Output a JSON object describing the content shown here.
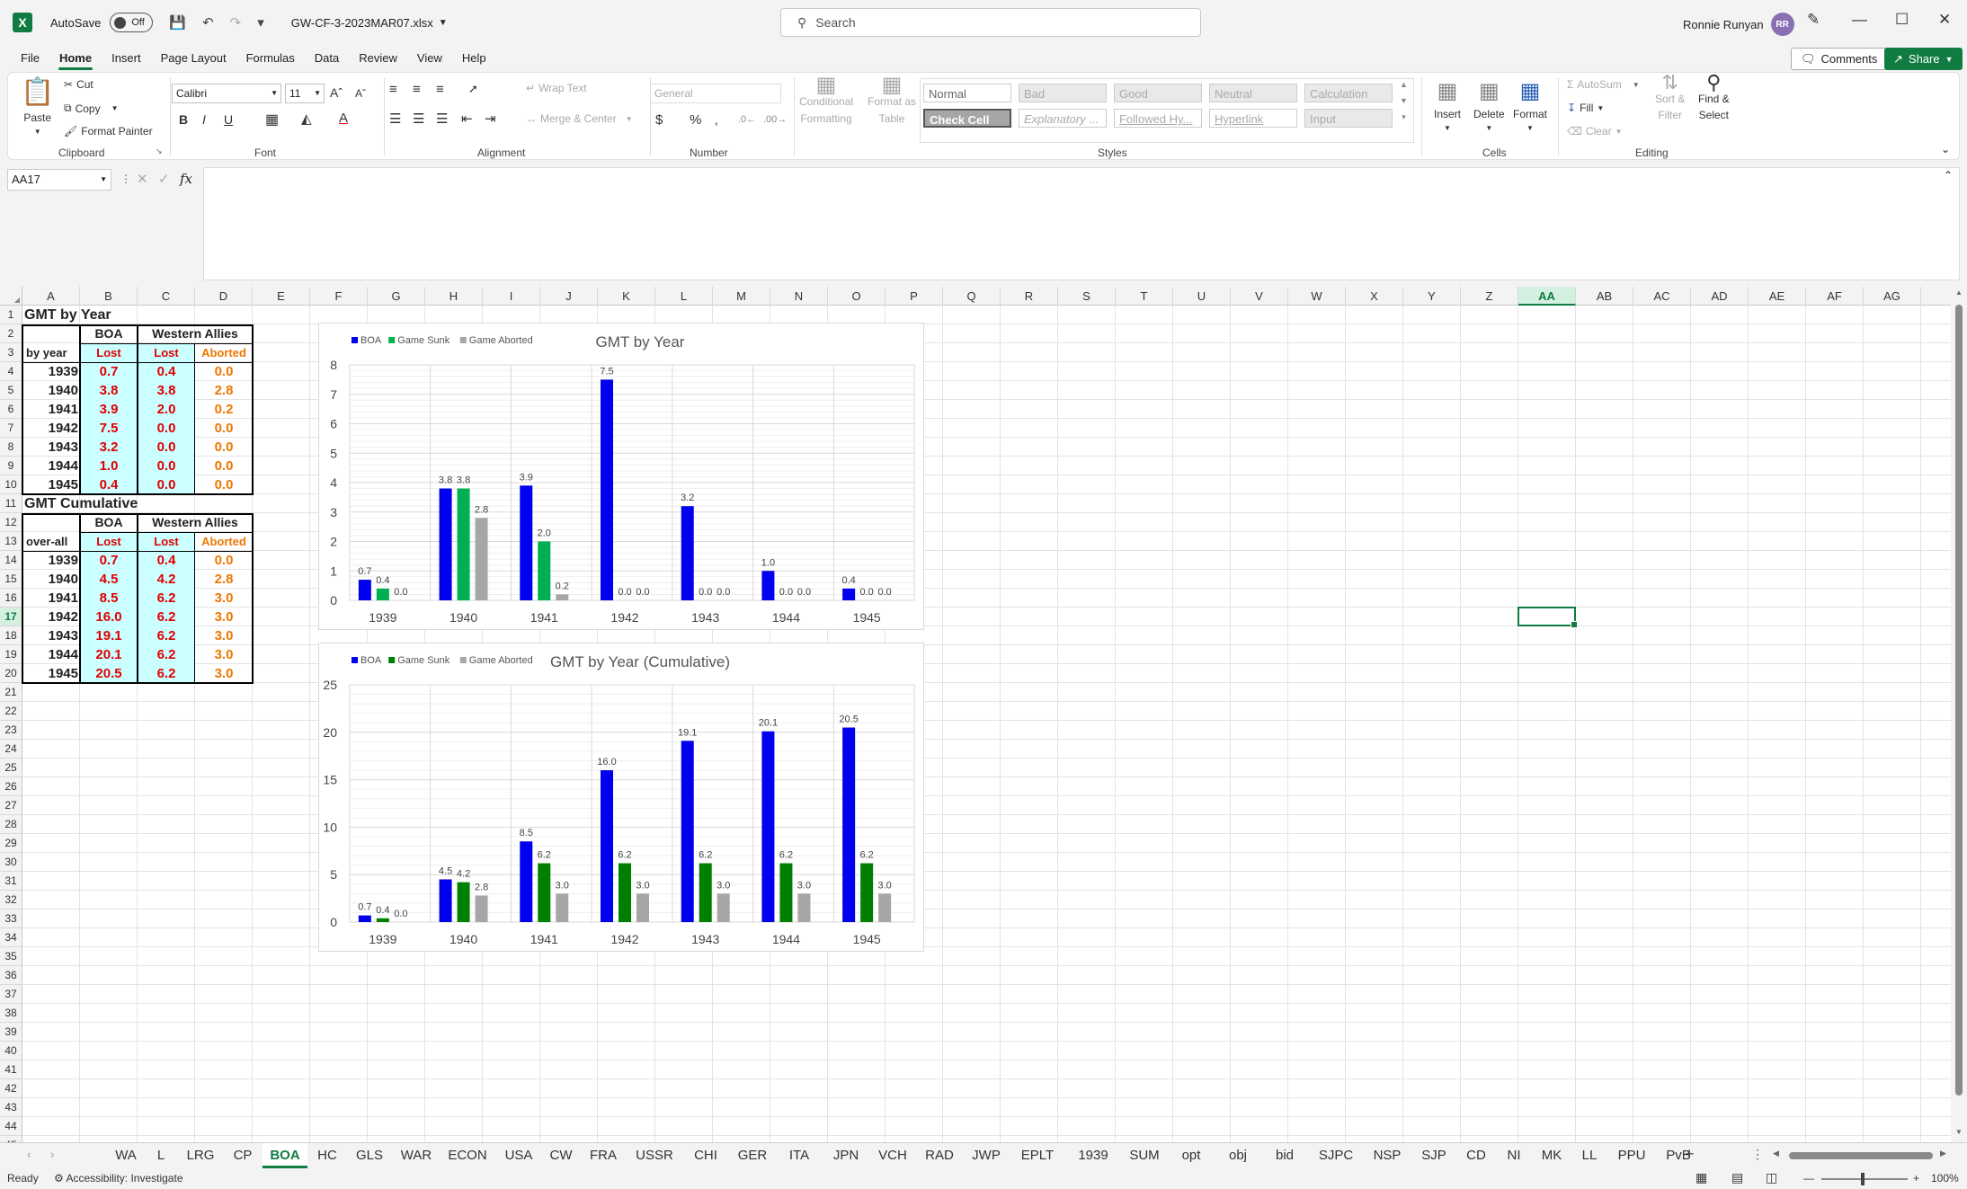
{
  "titlebar": {
    "autosave_label": "AutoSave",
    "autosave_state": "Off",
    "filename": "GW-CF-3-2023MAR07.xlsx",
    "search_placeholder": "Search",
    "user_name": "Ronnie Runyan",
    "user_initials": "RR"
  },
  "ribbon_tabs": [
    "File",
    "Home",
    "Insert",
    "Page Layout",
    "Formulas",
    "Data",
    "Review",
    "View",
    "Help"
  ],
  "active_tab": "Home",
  "comments_label": "Comments",
  "share_label": "Share",
  "ribbon": {
    "paste": "Paste",
    "cut": "Cut",
    "copy": "Copy",
    "format_painter": "Format Painter",
    "clipboard": "Clipboard",
    "font_name": "Calibri",
    "font_size": "11",
    "font": "Font",
    "wrap_text": "Wrap Text",
    "merge_center": "Merge & Center",
    "alignment": "Alignment",
    "number_format": "General",
    "number": "Number",
    "conditional_formatting_1": "Conditional",
    "conditional_formatting_2": "Formatting",
    "format_as_table_1": "Format as",
    "format_as_table_2": "Table",
    "styles": [
      "Normal",
      "Bad",
      "Good",
      "Neutral",
      "Calculation",
      "Check Cell",
      "Explanatory ...",
      "Followed Hy...",
      "Hyperlink",
      "Input"
    ],
    "styles_label": "Styles",
    "insert": "Insert",
    "delete": "Delete",
    "format": "Format",
    "cells": "Cells",
    "autosum": "AutoSum",
    "fill": "Fill",
    "clear": "Clear",
    "sort_filter_1": "Sort &",
    "sort_filter_2": "Filter",
    "find_select_1": "Find &",
    "find_select_2": "Select",
    "editing": "Editing"
  },
  "formula_bar": {
    "name_box": "AA17",
    "fx": "fx",
    "content": ""
  },
  "columns": [
    "A",
    "B",
    "C",
    "D",
    "E",
    "F",
    "G",
    "H",
    "I",
    "J",
    "K",
    "L",
    "M",
    "N",
    "O",
    "P",
    "Q",
    "R",
    "S",
    "T",
    "U",
    "V",
    "W",
    "X",
    "Y",
    "Z",
    "AA",
    "AB",
    "AC",
    "AD",
    "AE",
    "AF",
    "AG"
  ],
  "selected_column": "AA",
  "rows": [
    "1",
    "2",
    "3",
    "4",
    "5",
    "6",
    "7",
    "8",
    "9",
    "10",
    "11",
    "12",
    "13",
    "14",
    "15",
    "16",
    "17",
    "18",
    "19",
    "20",
    "21",
    "22",
    "23",
    "24",
    "25",
    "26",
    "27",
    "28",
    "29",
    "30",
    "31",
    "32",
    "33",
    "34",
    "35",
    "36",
    "37",
    "38",
    "39",
    "40",
    "41",
    "42",
    "43",
    "44",
    "45"
  ],
  "selected_row": "17",
  "table1": {
    "title": "GMT by Year",
    "hdr_boa": "BOA",
    "hdr_wa": "Western Allies",
    "row_label": "by year",
    "sub_lost": "Lost",
    "sub_lost2": "Lost",
    "sub_aborted": "Aborted",
    "years": [
      "1939",
      "1940",
      "1941",
      "1942",
      "1943",
      "1944",
      "1945"
    ],
    "boa": [
      "0.7",
      "3.8",
      "3.9",
      "7.5",
      "3.2",
      "1.0",
      "0.4"
    ],
    "wa_lost": [
      "0.4",
      "3.8",
      "2.0",
      "0.0",
      "0.0",
      "0.0",
      "0.0"
    ],
    "wa_aborted": [
      "0.0",
      "2.8",
      "0.2",
      "0.0",
      "0.0",
      "0.0",
      "0.0"
    ]
  },
  "table2": {
    "title": "GMT Cumulative",
    "hdr_boa": "BOA",
    "hdr_wa": "Western Allies",
    "row_label": "over-all",
    "sub_lost": "Lost",
    "sub_lost2": "Lost",
    "sub_aborted": "Aborted",
    "years": [
      "1939",
      "1940",
      "1941",
      "1942",
      "1943",
      "1944",
      "1945"
    ],
    "boa": [
      "0.7",
      "4.5",
      "8.5",
      "16.0",
      "19.1",
      "20.1",
      "20.5"
    ],
    "wa_lost": [
      "0.4",
      "4.2",
      "6.2",
      "6.2",
      "6.2",
      "6.2",
      "6.2"
    ],
    "wa_aborted": [
      "0.0",
      "2.8",
      "3.0",
      "3.0",
      "3.0",
      "3.0",
      "3.0"
    ]
  },
  "chart_data": [
    {
      "type": "bar",
      "title": "GMT by Year",
      "categories": [
        "1939",
        "1940",
        "1941",
        "1942",
        "1943",
        "1944",
        "1945"
      ],
      "series": [
        {
          "name": "BOA",
          "values": [
            0.7,
            3.8,
            3.9,
            7.5,
            3.2,
            1.0,
            0.4
          ],
          "color": "#0000ee"
        },
        {
          "name": "Game Sunk",
          "values": [
            0.4,
            3.8,
            2.0,
            0.0,
            0.0,
            0.0,
            0.0
          ],
          "color": "#00b050"
        },
        {
          "name": "Game Aborted",
          "values": [
            0.0,
            2.8,
            0.2,
            0.0,
            0.0,
            0.0,
            0.0
          ],
          "color": "#a6a6a6"
        }
      ],
      "ylim": [
        0,
        8
      ],
      "yticks": [
        0,
        1,
        2,
        3,
        4,
        5,
        6,
        7,
        8
      ],
      "legend": "top-left",
      "grid": true
    },
    {
      "type": "bar",
      "title": "GMT by Year (Cumulative)",
      "categories": [
        "1939",
        "1940",
        "1941",
        "1942",
        "1943",
        "1944",
        "1945"
      ],
      "series": [
        {
          "name": "BOA",
          "values": [
            0.7,
            4.5,
            8.5,
            16.0,
            19.1,
            20.1,
            20.5
          ],
          "color": "#0000ee"
        },
        {
          "name": "Game Sunk",
          "values": [
            0.4,
            4.2,
            6.2,
            6.2,
            6.2,
            6.2,
            6.2
          ],
          "color": "#008000"
        },
        {
          "name": "Game Aborted",
          "values": [
            0.0,
            2.8,
            3.0,
            3.0,
            3.0,
            3.0,
            3.0
          ],
          "color": "#a6a6a6"
        }
      ],
      "ylim": [
        0,
        25
      ],
      "yticks": [
        0,
        5,
        10,
        15,
        20,
        25
      ],
      "legend": "top-left",
      "grid": true
    }
  ],
  "sheet_tabs": [
    "WA",
    "L",
    "LRG",
    "CP",
    "BOA",
    "HC",
    "GLS",
    "WAR",
    "ECON",
    "USA",
    "CW",
    "FRA",
    "USSR",
    "CHI",
    "GER",
    "ITA",
    "JPN",
    "VCH",
    "RAD",
    "JWP",
    "EPLT",
    "1939",
    "SUM",
    "opt",
    "obj",
    "bid",
    "SJPC",
    "NSP",
    "SJP",
    "CD",
    "NI",
    "MK",
    "LL",
    "PPU",
    "PvB"
  ],
  "active_sheet": "BOA",
  "status": {
    "ready": "Ready",
    "accessibility": "Accessibility: Investigate",
    "zoom": "100%"
  }
}
